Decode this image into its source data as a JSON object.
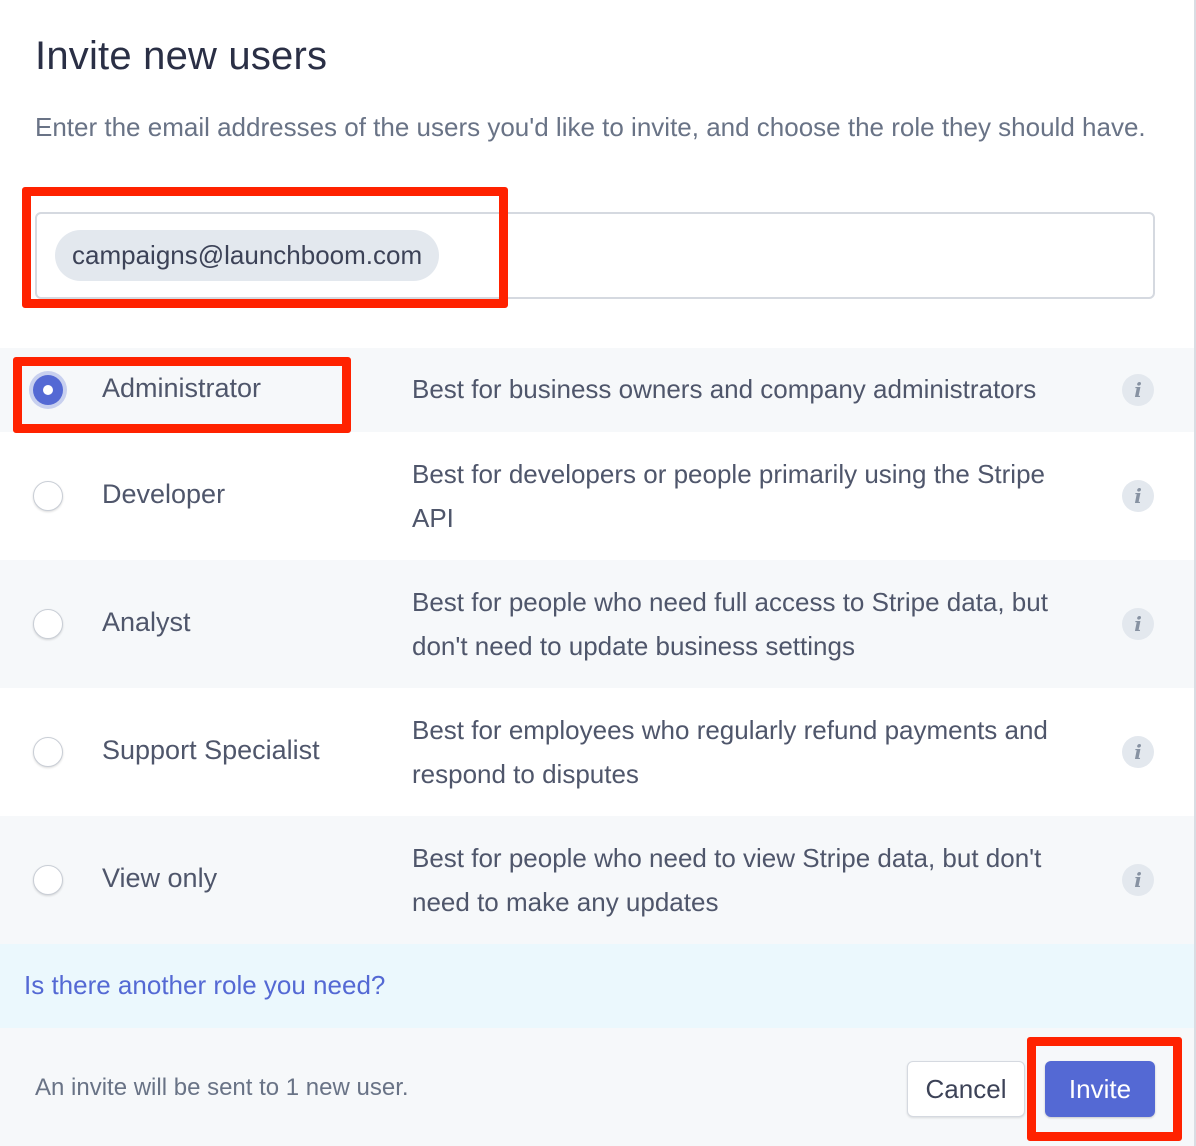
{
  "dialog": {
    "title": "Invite new users",
    "subtitle": "Enter the email addresses of the users you'd like to invite, and choose the role they should have."
  },
  "email_input": {
    "chips": [
      "campaigns@launchboom.com"
    ]
  },
  "roles": [
    {
      "name": "Administrator",
      "description": "Best for business owners and company administrators",
      "selected": true
    },
    {
      "name": "Developer",
      "description": "Best for developers or people primarily using the Stripe API",
      "selected": false
    },
    {
      "name": "Analyst",
      "description": "Best for people who need full access to Stripe data, but don't need to update business settings",
      "selected": false
    },
    {
      "name": "Support Specialist",
      "description": "Best for employees who regularly refund payments and respond to disputes",
      "selected": false
    },
    {
      "name": "View only",
      "description": "Best for people who need to view Stripe data, but don't need to make any updates",
      "selected": false
    }
  ],
  "info_icon": "info-icon",
  "help_link": "Is there another role you need?",
  "footer": {
    "note": "An invite will be sent to 1 new user.",
    "cancel_label": "Cancel",
    "invite_label": "Invite"
  },
  "colors": {
    "accent": "#5469d4",
    "annotation": "#ff2200",
    "help_bg": "#ebf8fd"
  }
}
